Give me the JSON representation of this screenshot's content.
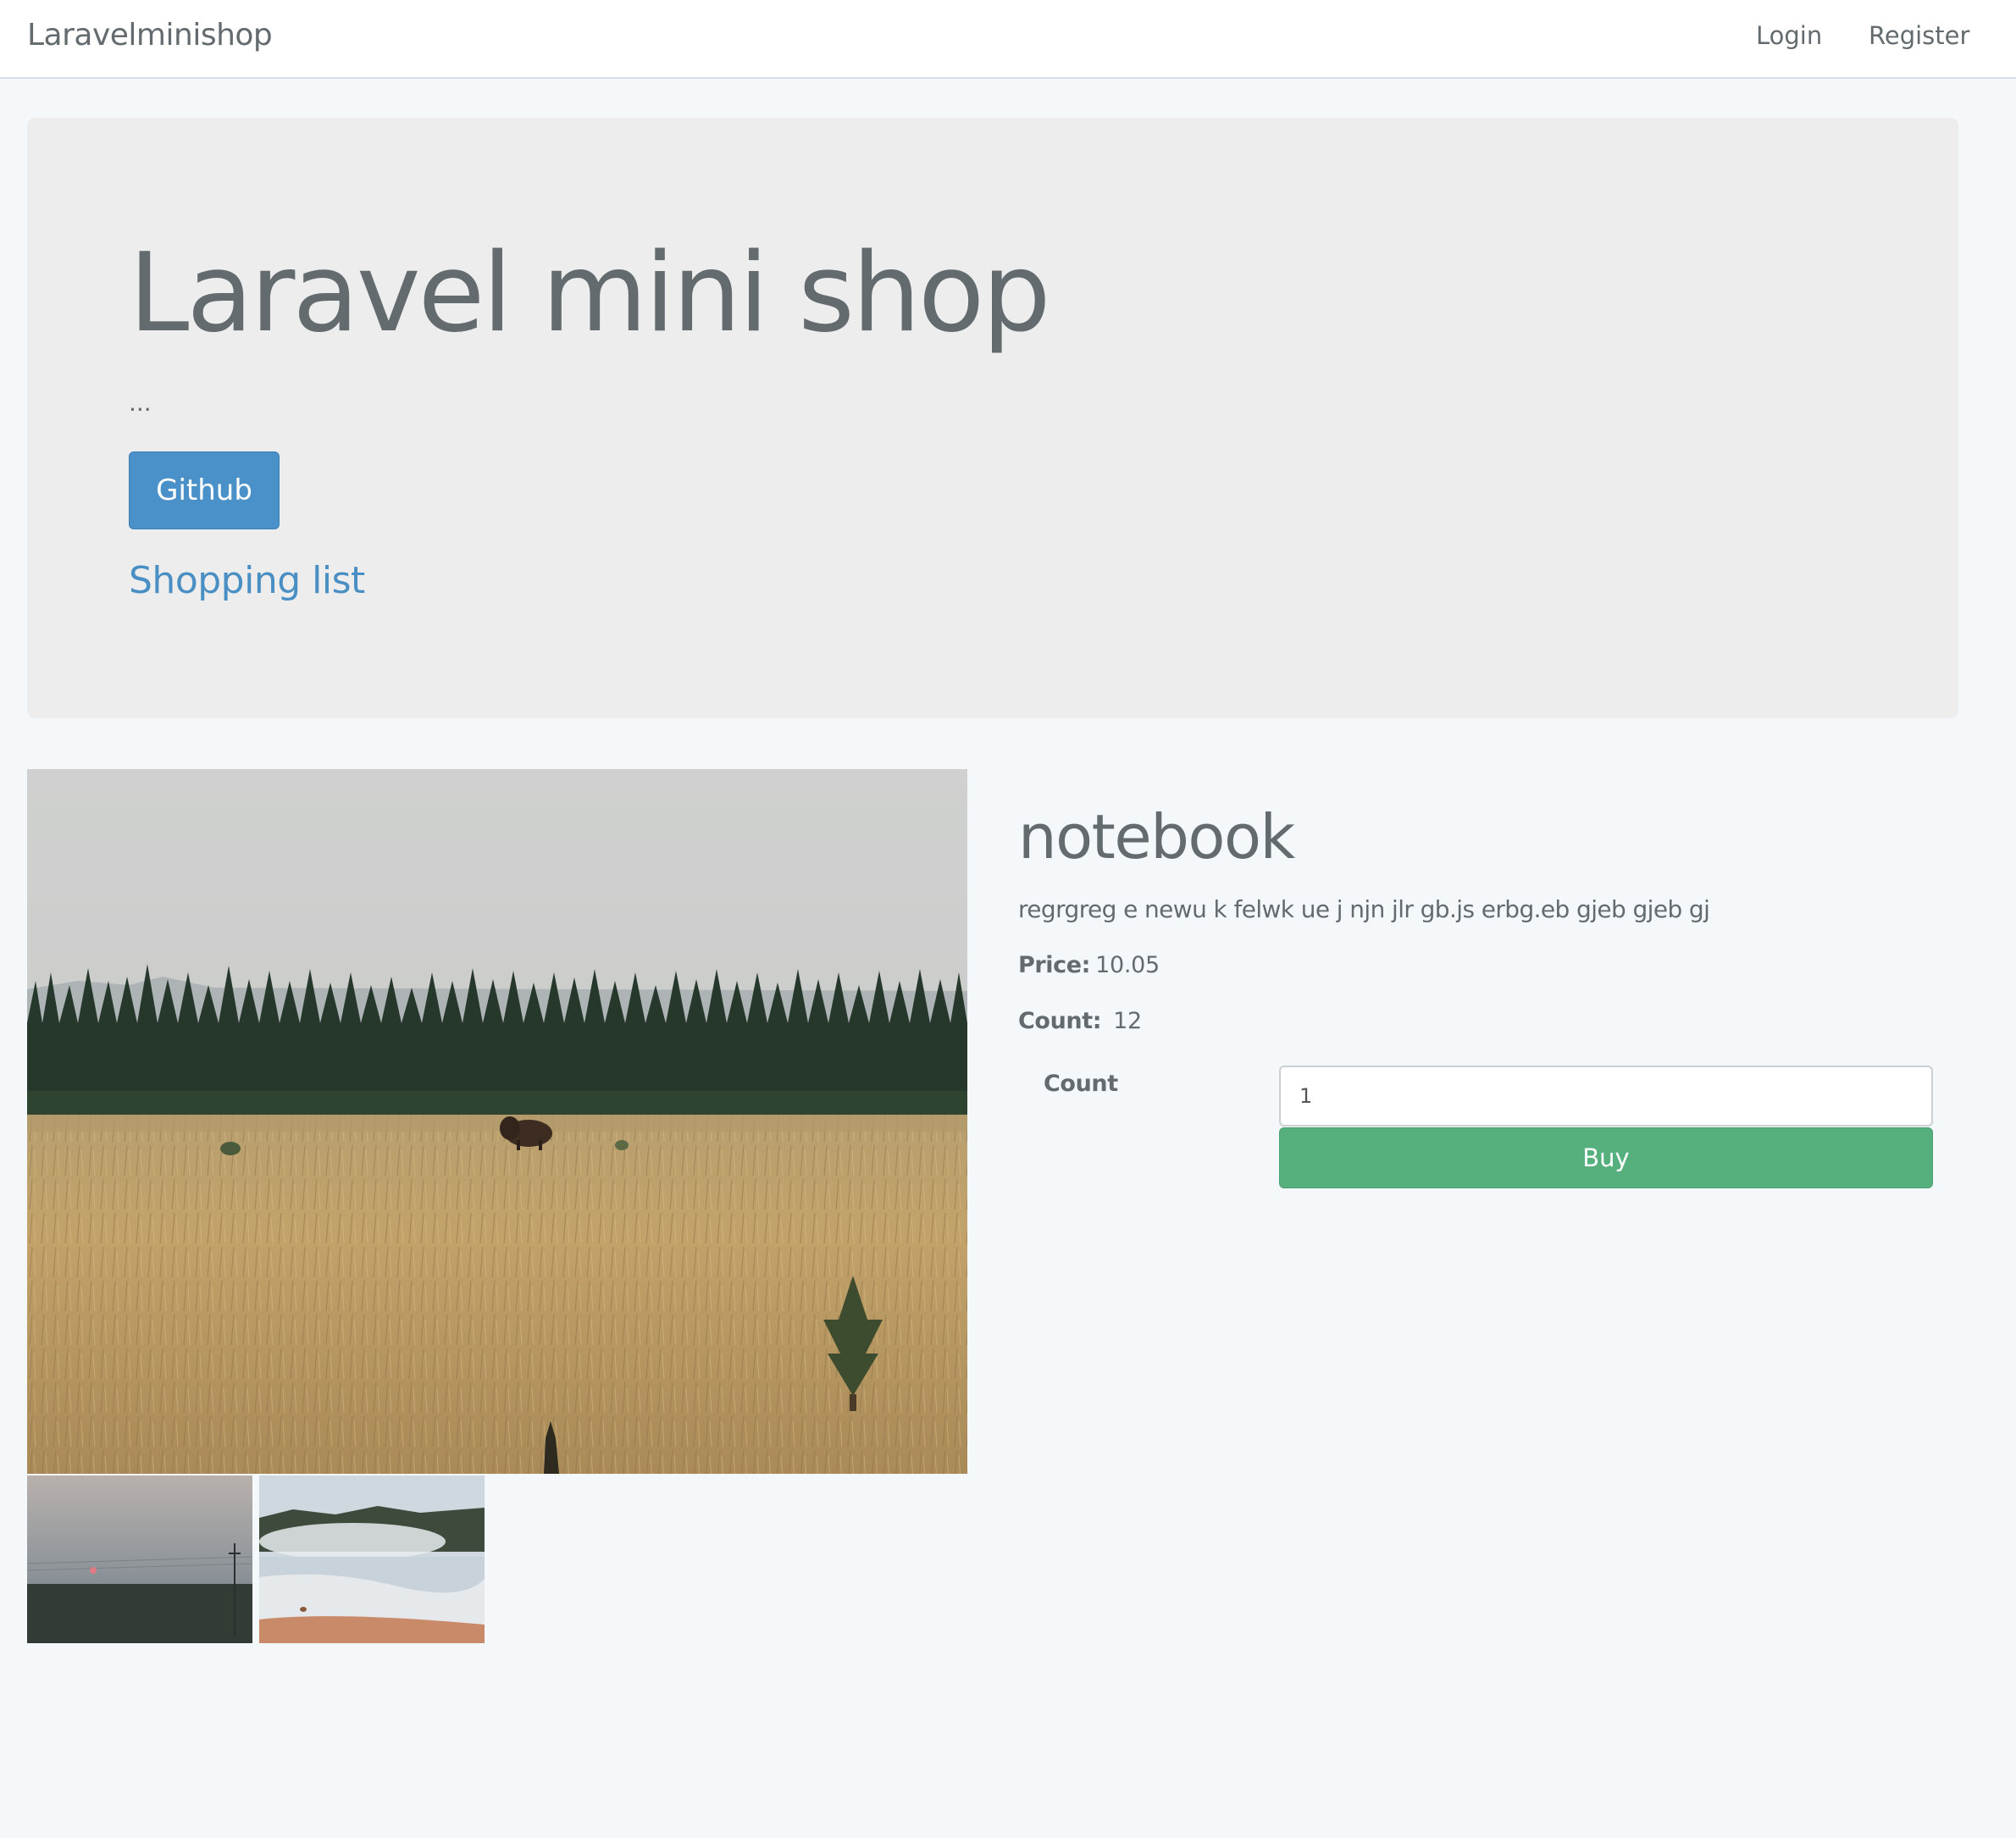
{
  "navbar": {
    "brand": "Laravelminishop",
    "login_label": "Login",
    "register_label": "Register"
  },
  "jumbotron": {
    "title": "Laravel mini shop",
    "lead": "...",
    "github_label": "Github",
    "shopping_list_label": "Shopping list"
  },
  "product": {
    "name": "notebook",
    "description": "regrgreg e newu k felwk ue j njn jlr gb.js erbg.eb gjeb gjeb gj",
    "price_label": "Price:",
    "price_value": "10.05",
    "count_label": "Count:",
    "count_value": "12",
    "images": [
      {
        "name": "main-image",
        "depicts": "prairie with bison and pine forest"
      },
      {
        "name": "thumbnail-1",
        "depicts": "sunset over plain"
      },
      {
        "name": "thumbnail-2",
        "depicts": "steaming hot spring"
      }
    ]
  },
  "buy_form": {
    "count_label": "Count",
    "count_input_value": "1",
    "buy_label": "Buy"
  },
  "colors": {
    "page_background": "#f5f8fa",
    "jumbotron_background": "#ededed",
    "primary": "#4a90c9",
    "link": "#4a8fc4",
    "success": "#56b07d",
    "text": "#636b6f"
  }
}
